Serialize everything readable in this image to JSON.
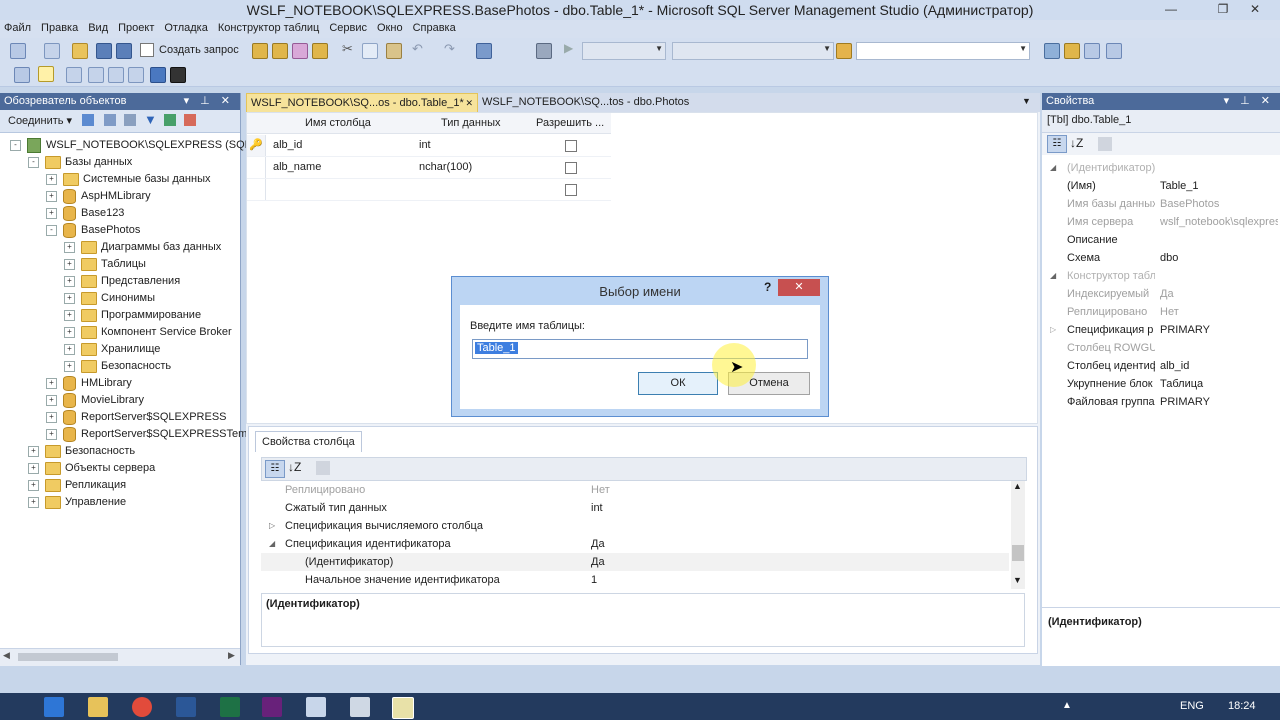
{
  "window": {
    "title": "WSLF_NOTEBOOK\\SQLEXPRESS.BasePhotos - dbo.Table_1* - Microsoft SQL Server Management Studio (Администратор)"
  },
  "menu": [
    "Файл",
    "Правка",
    "Вид",
    "Проект",
    "Отладка",
    "Конструктор таблиц",
    "Сервис",
    "Окно",
    "Справка"
  ],
  "toolbar": {
    "new_query_label": "Создать запрос"
  },
  "object_explorer": {
    "title": "Обозреватель объектов",
    "connect_label": "Соединить",
    "tree": [
      {
        "label": "WSLF_NOTEBOOK\\SQLEXPRESS (SQL S",
        "level": 0,
        "icon": "server",
        "expander": "-"
      },
      {
        "label": "Базы данных",
        "level": 1,
        "icon": "folder",
        "expander": "-"
      },
      {
        "label": "Системные базы данных",
        "level": 2,
        "icon": "folder",
        "expander": "+"
      },
      {
        "label": "AspHMLibrary",
        "level": 2,
        "icon": "db",
        "expander": "+"
      },
      {
        "label": "Base123",
        "level": 2,
        "icon": "db",
        "expander": "+"
      },
      {
        "label": "BasePhotos",
        "level": 2,
        "icon": "db",
        "expander": "-"
      },
      {
        "label": "Диаграммы баз данных",
        "level": 3,
        "icon": "folder",
        "expander": "+"
      },
      {
        "label": "Таблицы",
        "level": 3,
        "icon": "folder",
        "expander": "+"
      },
      {
        "label": "Представления",
        "level": 3,
        "icon": "folder",
        "expander": "+"
      },
      {
        "label": "Синонимы",
        "level": 3,
        "icon": "folder",
        "expander": "+"
      },
      {
        "label": "Программирование",
        "level": 3,
        "icon": "folder",
        "expander": "+"
      },
      {
        "label": "Компонент Service Broker",
        "level": 3,
        "icon": "folder",
        "expander": "+"
      },
      {
        "label": "Хранилище",
        "level": 3,
        "icon": "folder",
        "expander": "+"
      },
      {
        "label": "Безопасность",
        "level": 3,
        "icon": "folder",
        "expander": "+"
      },
      {
        "label": "HMLibrary",
        "level": 2,
        "icon": "db",
        "expander": "+"
      },
      {
        "label": "MovieLibrary",
        "level": 2,
        "icon": "db",
        "expander": "+"
      },
      {
        "label": "ReportServer$SQLEXPRESS",
        "level": 2,
        "icon": "db",
        "expander": "+"
      },
      {
        "label": "ReportServer$SQLEXPRESSTemp",
        "level": 2,
        "icon": "db",
        "expander": "+"
      },
      {
        "label": "Безопасность",
        "level": 1,
        "icon": "folder",
        "expander": "+"
      },
      {
        "label": "Объекты сервера",
        "level": 1,
        "icon": "folder",
        "expander": "+"
      },
      {
        "label": "Репликация",
        "level": 1,
        "icon": "folder",
        "expander": "+"
      },
      {
        "label": "Управление",
        "level": 1,
        "icon": "folder",
        "expander": "+"
      }
    ]
  },
  "tabs": [
    {
      "label": "WSLF_NOTEBOOK\\SQ...os - dbo.Table_1*",
      "active": true
    },
    {
      "label": "WSLF_NOTEBOOK\\SQ...tos - dbo.Photos",
      "active": false
    }
  ],
  "grid": {
    "headers": [
      "Имя столбца",
      "Тип данных",
      "Разрешить ..."
    ],
    "rows": [
      {
        "name": "alb_id",
        "type": "int",
        "key": true
      },
      {
        "name": "alb_name",
        "type": "nchar(100)",
        "key": false
      },
      {
        "name": "",
        "type": "",
        "key": false
      }
    ]
  },
  "column_props": {
    "tab_label": "Свойства столбца",
    "rows": [
      {
        "name": "Реплицировано",
        "value": "Нет",
        "gray": true,
        "indent": 0,
        "exp": ""
      },
      {
        "name": "Сжатый тип данных",
        "value": "int",
        "gray": false,
        "indent": 0,
        "exp": ""
      },
      {
        "name": "Спецификация вычисляемого столбца",
        "value": "",
        "gray": false,
        "indent": 0,
        "exp": "▷"
      },
      {
        "name": "Спецификация идентификатора",
        "value": "Да",
        "gray": false,
        "indent": 0,
        "exp": "◢"
      },
      {
        "name": "(Идентификатор)",
        "value": "Да",
        "gray": false,
        "indent": 1,
        "exp": ""
      },
      {
        "name": "Начальное значение идентификатора",
        "value": "1",
        "gray": false,
        "indent": 1,
        "exp": ""
      }
    ],
    "description_title": "(Идентификатор)"
  },
  "dialog": {
    "title": "Выбор имени",
    "help": "?",
    "prompt": "Введите имя таблицы:",
    "value": "Table_1",
    "ok_label": "ОК",
    "cancel_label": "Отмена"
  },
  "properties": {
    "title": "Свойства",
    "object_label": "[Tbl] dbo.Table_1",
    "rows": [
      {
        "kind": "cat",
        "name": "(Идентификатор)"
      },
      {
        "kind": "prop",
        "name": "(Имя)",
        "value": "Table_1",
        "gray": false
      },
      {
        "kind": "prop",
        "name": "Имя базы данных",
        "value": "BasePhotos",
        "gray": true
      },
      {
        "kind": "prop",
        "name": "Имя сервера",
        "value": "wslf_notebook\\sqlexpress",
        "gray": true
      },
      {
        "kind": "prop",
        "name": "Описание",
        "value": "",
        "gray": false
      },
      {
        "kind": "prop",
        "name": "Схема",
        "value": "dbo",
        "gray": false
      },
      {
        "kind": "cat",
        "name": "Конструктор таблиц"
      },
      {
        "kind": "prop",
        "name": "Индексируемый",
        "value": "Да",
        "gray": true
      },
      {
        "kind": "prop",
        "name": "Реплицировано",
        "value": "Нет",
        "gray": true
      },
      {
        "kind": "prop",
        "name": "Спецификация р",
        "value": "PRIMARY",
        "gray": false,
        "exp": "▷"
      },
      {
        "kind": "prop",
        "name": "Столбец ROWGU",
        "value": "",
        "gray": true
      },
      {
        "kind": "prop",
        "name": "Столбец идентиф",
        "value": "alb_id",
        "gray": false
      },
      {
        "kind": "prop",
        "name": "Укрупнение блок",
        "value": "Таблица",
        "gray": false
      },
      {
        "kind": "prop",
        "name": "Файловая группа",
        "value": "PRIMARY",
        "gray": false
      }
    ],
    "description_title": "(Идентификатор)"
  },
  "taskbar": {
    "lang": "ENG",
    "time": "18:24"
  }
}
